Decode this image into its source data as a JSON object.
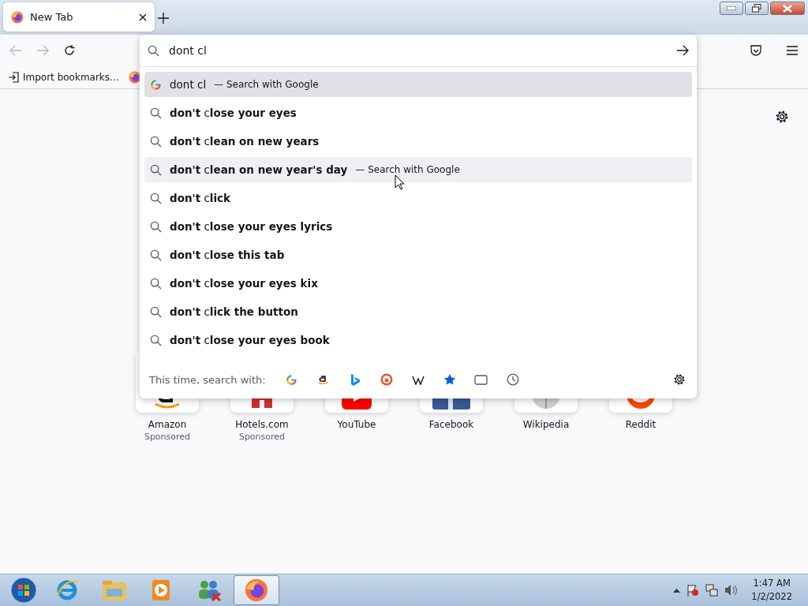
{
  "tabs": [
    {
      "label": "New Tab",
      "selected": true
    }
  ],
  "address_bar": {
    "value": "dont cl"
  },
  "bookmarks": [
    {
      "label": "Import bookmarks..."
    }
  ],
  "suggestions": [
    {
      "kind": "engine",
      "text": "dont cl",
      "action": "— Search with Google",
      "selected": true,
      "hovered": false
    },
    {
      "kind": "suggestion",
      "text": "**don't** c**lose your eyes**",
      "selected": false,
      "hovered": false
    },
    {
      "kind": "suggestion",
      "text": "**don't** c**lean on new years**",
      "selected": false,
      "hovered": false
    },
    {
      "kind": "suggestion",
      "text": "**don't** c**lean on new year's day**",
      "action": "— Search with Google",
      "selected": false,
      "hovered": true
    },
    {
      "kind": "suggestion",
      "text": "**don't** c**lick**",
      "selected": false,
      "hovered": false
    },
    {
      "kind": "suggestion",
      "text": "**don't** c**lose your eyes lyrics**",
      "selected": false,
      "hovered": false
    },
    {
      "kind": "suggestion",
      "text": "**don't** c**lose this tab**",
      "selected": false,
      "hovered": false
    },
    {
      "kind": "suggestion",
      "text": "**don't** c**lose your eyes kix**",
      "selected": false,
      "hovered": false
    },
    {
      "kind": "suggestion",
      "text": "**don't** c**lick the button**",
      "selected": false,
      "hovered": false
    },
    {
      "kind": "suggestion",
      "text": "**don't** c**lose your eyes book**",
      "selected": false,
      "hovered": false
    }
  ],
  "one_off": {
    "label": "This time, search with:",
    "engines": [
      {
        "kind": "google"
      },
      {
        "kind": "amazon"
      },
      {
        "kind": "bing"
      },
      {
        "kind": "duckduckgo"
      },
      {
        "kind": "wikipedia"
      },
      {
        "kind": "bookmarks"
      },
      {
        "kind": "tabs"
      },
      {
        "kind": "history"
      }
    ]
  },
  "top_sites": [
    {
      "kind": "amazon",
      "name": "Amazon",
      "note": "Sponsored"
    },
    {
      "kind": "hotels",
      "name": "Hotels.com",
      "note": "Sponsored"
    },
    {
      "kind": "youtube",
      "name": "YouTube"
    },
    {
      "kind": "facebook",
      "name": "Facebook"
    },
    {
      "kind": "wikipedia",
      "name": "Wikipedia"
    },
    {
      "kind": "reddit",
      "name": "Reddit"
    }
  ],
  "taskbar": {
    "apps": [
      {
        "kind": "ie",
        "active": false
      },
      {
        "kind": "explorer",
        "active": false
      },
      {
        "kind": "media",
        "active": false
      },
      {
        "kind": "people",
        "active": false
      },
      {
        "kind": "firefox",
        "active": true
      }
    ],
    "time": "1:47 AM",
    "date": "1/2/2022"
  }
}
